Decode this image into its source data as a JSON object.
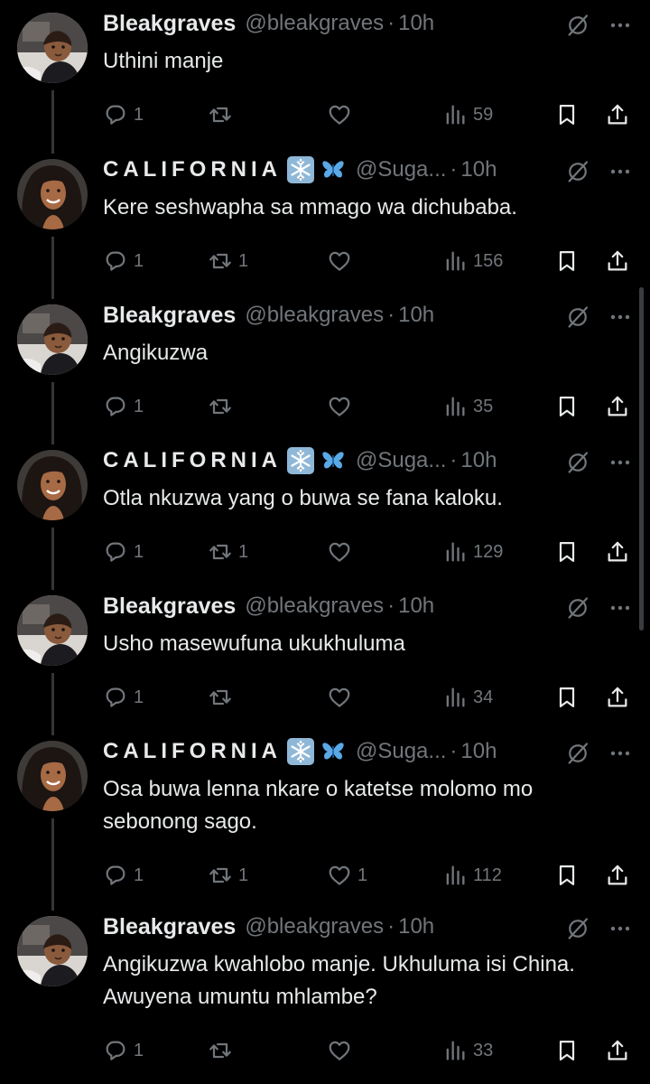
{
  "colors": {
    "background": "#000000",
    "primary_text": "#e7e9ea",
    "secondary_text": "#71767b",
    "thread_line": "#333639"
  },
  "icons": {
    "reply": "reply-icon",
    "repost": "repost-icon",
    "like": "heart-icon",
    "views": "views-icon",
    "bookmark": "bookmark-icon",
    "share": "share-icon",
    "grok": "grok-icon",
    "more": "more-icon"
  },
  "tweets": [
    {
      "author": "Bleakgraves",
      "handle": "@bleakgraves",
      "sep": "·",
      "time": "10h",
      "text": "Uthini manje",
      "replies": "1",
      "reposts": "",
      "likes": "",
      "views": "59"
    },
    {
      "author": "CALIFORNIA",
      "handle": "@Suga...",
      "sep": "·",
      "time": "10h",
      "text": "Kere seshwapha sa mmago wa dichubaba.",
      "replies": "1",
      "reposts": "1",
      "likes": "",
      "views": "156"
    },
    {
      "author": "Bleakgraves",
      "handle": "@bleakgraves",
      "sep": "·",
      "time": "10h",
      "text": "Angikuzwa",
      "replies": "1",
      "reposts": "",
      "likes": "",
      "views": "35"
    },
    {
      "author": "CALIFORNIA",
      "handle": "@Suga...",
      "sep": "·",
      "time": "10h",
      "text": "Otla nkuzwa yang o buwa se fana kaloku.",
      "replies": "1",
      "reposts": "1",
      "likes": "",
      "views": "129"
    },
    {
      "author": "Bleakgraves",
      "handle": "@bleakgraves",
      "sep": "·",
      "time": "10h",
      "text": "Usho masewufuna ukukhuluma",
      "replies": "1",
      "reposts": "",
      "likes": "",
      "views": "34"
    },
    {
      "author": "CALIFORNIA",
      "handle": "@Suga...",
      "sep": "·",
      "time": "10h",
      "text": "Osa buwa lenna nkare o katetse molomo mo sebonong sago.",
      "replies": "1",
      "reposts": "1",
      "likes": "1",
      "views": "112"
    },
    {
      "author": "Bleakgraves",
      "handle": "@bleakgraves",
      "sep": "·",
      "time": "10h",
      "text": "Angikuzwa kwahlobo manje. Ukhuluma isi China. Awuyena umuntu mhlambe?",
      "replies": "1",
      "reposts": "",
      "likes": "",
      "views": "33"
    }
  ]
}
